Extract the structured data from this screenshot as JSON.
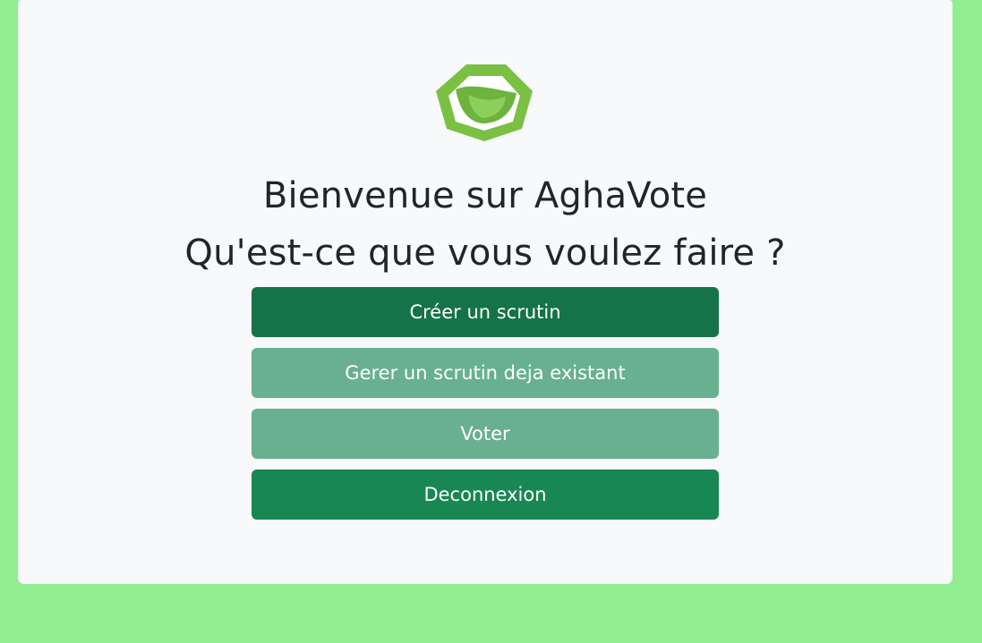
{
  "welcome": {
    "title": "Bienvenue sur AghaVote",
    "question": "Qu'est-ce que vous voulez faire ?"
  },
  "actions": [
    {
      "label": "Créer un scrutin",
      "color": "#157347"
    },
    {
      "label": "Gerer un scrutin deja existant",
      "color": "#68b08f"
    },
    {
      "label": "Voter",
      "color": "#68b08f"
    },
    {
      "label": "Deconnexion",
      "color": "#198754"
    }
  ],
  "colors": {
    "page_background": "#90ee90",
    "card_background": "#f8f9fa",
    "logo_green": "#7ac143"
  },
  "logo": {
    "icon": "leaf-hexagon-logo-icon"
  }
}
